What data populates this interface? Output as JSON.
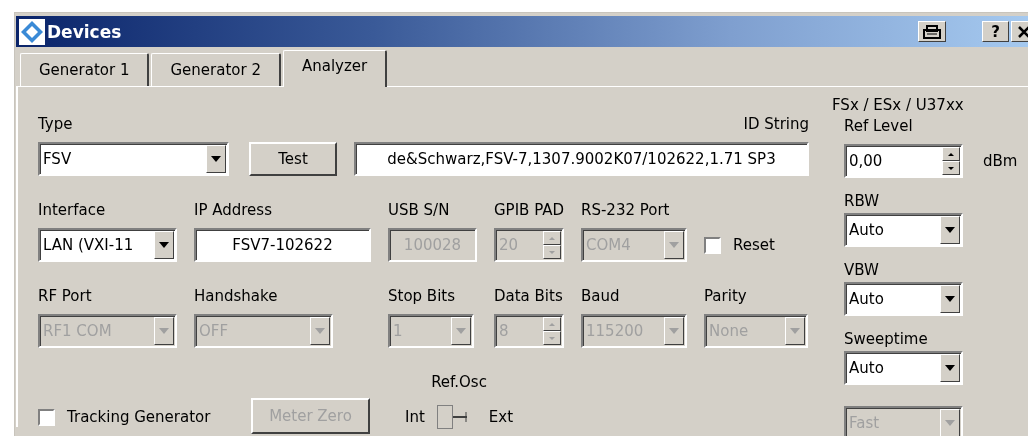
{
  "window": {
    "title": "Devices",
    "help_label": "?"
  },
  "tabs": [
    {
      "label": "Generator 1",
      "selected": false
    },
    {
      "label": "Generator 2",
      "selected": false
    },
    {
      "label": "Analyzer",
      "selected": true
    }
  ],
  "rows": [
    [
      {
        "kind": "combo",
        "label": "Type",
        "value": "FSV",
        "disabled": false
      },
      {
        "kind": "button",
        "text": "Test",
        "disabled": false
      },
      {
        "kind": "text",
        "label": "ID String",
        "value": "de&Schwarz,FSV-7,1307.9002K07/102622,1.71 SP3",
        "disabled": false
      }
    ],
    [
      {
        "kind": "combo",
        "label": "Interface",
        "value": "LAN (VXI-11",
        "disabled": false
      },
      {
        "kind": "text",
        "label": "IP Address",
        "value": "FSV7-102622",
        "disabled": false
      },
      {
        "kind": "text",
        "label": "USB S/N",
        "value": "100028",
        "disabled": true
      },
      {
        "kind": "spinner",
        "label": "GPIB PAD",
        "value": "20",
        "disabled": true
      },
      {
        "kind": "combo",
        "label": "RS-232 Port",
        "value": "COM4",
        "disabled": true
      },
      {
        "kind": "checkbox",
        "text": "Reset",
        "checked": false
      }
    ],
    [
      {
        "kind": "combo",
        "label": "RF Port",
        "value": "RF1 COM",
        "disabled": true
      },
      {
        "kind": "combo",
        "label": "Handshake",
        "value": "OFF",
        "disabled": true
      },
      {
        "kind": "combo",
        "label": "Stop Bits",
        "value": "1",
        "disabled": true
      },
      {
        "kind": "spinner",
        "label": "Data Bits",
        "value": "8",
        "disabled": true
      },
      {
        "kind": "combo",
        "label": "Baud",
        "value": "115200",
        "disabled": true
      },
      {
        "kind": "combo",
        "label": "Parity",
        "value": "None",
        "disabled": true
      }
    ],
    [
      {
        "kind": "checkbox",
        "text": "Tracking Generator",
        "checked": false
      },
      {
        "kind": "button",
        "text": "Meter Zero",
        "disabled": true
      },
      {
        "kind": "toggle",
        "label": "Ref.Osc",
        "left": "Int",
        "right": "Ext",
        "on": false
      }
    ]
  ],
  "side_panel": {
    "heading": "FSx / ESx / U37xx",
    "items": [
      {
        "kind": "spinner",
        "label": "Ref Level",
        "value": "0,00",
        "unit": "dBm",
        "disabled": false
      },
      {
        "kind": "combo",
        "label": "RBW",
        "value": "Auto",
        "disabled": false
      },
      {
        "kind": "combo",
        "label": "VBW",
        "value": "Auto",
        "disabled": false
      },
      {
        "kind": "combo",
        "label": "Sweeptime",
        "value": "Auto",
        "disabled": false
      },
      {
        "kind": "combo",
        "value": "Fast",
        "disabled": true
      }
    ]
  }
}
